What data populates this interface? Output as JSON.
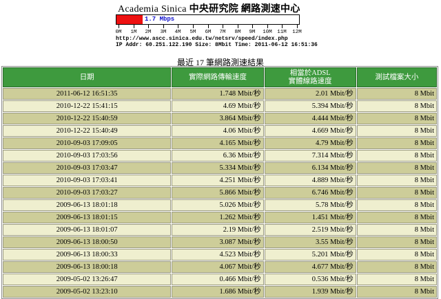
{
  "header": {
    "title_en": "Academia Sinica",
    "title_cjk": "中央研究院 網路測速中心",
    "speed_label": "1.7 Mbps",
    "speed_mbps": 1.748,
    "scale_max_mbps": 12,
    "scale_labels": [
      "0M",
      "1M",
      "2M",
      "3M",
      "4M",
      "5M",
      "6M",
      "7M",
      "8M",
      "9M",
      "10M",
      "11M",
      "12M"
    ],
    "url": "http://www.ascc.sinica.edu.tw/netsrv/speed/index.php",
    "info_line": "IP Addr: 60.251.122.190 Size: 8Mbit Time: 2011-06-12 16:51:36",
    "fill_color": "#ee1111"
  },
  "caption": "最近 17 筆網路測速結果",
  "table": {
    "headers": {
      "date": "日期",
      "actual_speed": "實際網路傳輸速度",
      "adsl_line1": "相當於ADSL",
      "adsl_line2": "實體線路速度",
      "file_size": "測試檔案大小"
    },
    "rows": [
      [
        "2011-06-12 16:51:35",
        "1.748 Mbit/秒",
        "2.01 Mbit/秒",
        "8 Mbit"
      ],
      [
        "2010-12-22 15:41:15",
        "4.69 Mbit/秒",
        "5.394 Mbit/秒",
        "8 Mbit"
      ],
      [
        "2010-12-22 15:40:59",
        "3.864 Mbit/秒",
        "4.444 Mbit/秒",
        "8 Mbit"
      ],
      [
        "2010-12-22 15:40:49",
        "4.06 Mbit/秒",
        "4.669 Mbit/秒",
        "8 Mbit"
      ],
      [
        "2010-09-03 17:09:05",
        "4.165 Mbit/秒",
        "4.79 Mbit/秒",
        "8 Mbit"
      ],
      [
        "2010-09-03 17:03:56",
        "6.36 Mbit/秒",
        "7.314 Mbit/秒",
        "8 Mbit"
      ],
      [
        "2010-09-03 17:03:47",
        "5.334 Mbit/秒",
        "6.134 Mbit/秒",
        "8 Mbit"
      ],
      [
        "2010-09-03 17:03:41",
        "4.251 Mbit/秒",
        "4.889 Mbit/秒",
        "8 Mbit"
      ],
      [
        "2010-09-03 17:03:27",
        "5.866 Mbit/秒",
        "6.746 Mbit/秒",
        "8 Mbit"
      ],
      [
        "2009-06-13 18:01:18",
        "5.026 Mbit/秒",
        "5.78 Mbit/秒",
        "8 Mbit"
      ],
      [
        "2009-06-13 18:01:15",
        "1.262 Mbit/秒",
        "1.451 Mbit/秒",
        "8 Mbit"
      ],
      [
        "2009-06-13 18:01:07",
        "2.19 Mbit/秒",
        "2.519 Mbit/秒",
        "8 Mbit"
      ],
      [
        "2009-06-13 18:00:50",
        "3.087 Mbit/秒",
        "3.55 Mbit/秒",
        "8 Mbit"
      ],
      [
        "2009-06-13 18:00:33",
        "4.523 Mbit/秒",
        "5.201 Mbit/秒",
        "8 Mbit"
      ],
      [
        "2009-06-13 18:00:18",
        "4.067 Mbit/秒",
        "4.677 Mbit/秒",
        "8 Mbit"
      ],
      [
        "2009-05-02 13:26:47",
        "0.466 Mbit/秒",
        "0.536 Mbit/秒",
        "8 Mbit"
      ],
      [
        "2009-05-02 13:23:10",
        "1.686 Mbit/秒",
        "1.939 Mbit/秒",
        "8 Mbit"
      ]
    ]
  }
}
